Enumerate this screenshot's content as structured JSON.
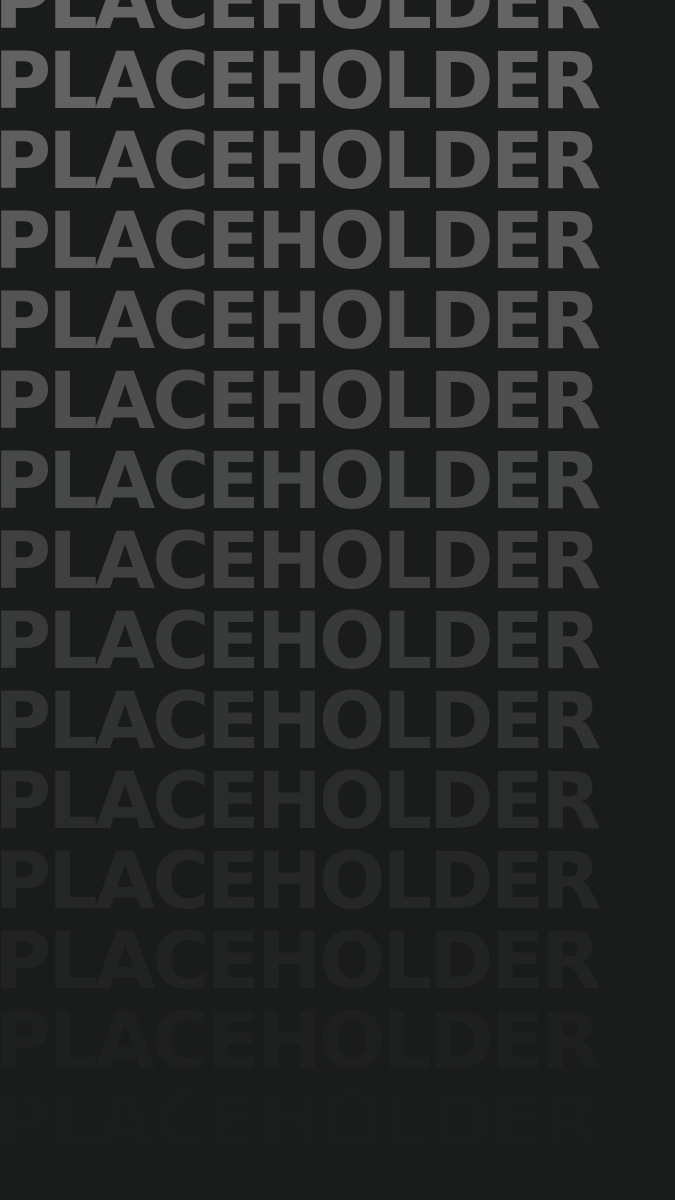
{
  "background_color": "#1a1b1b",
  "text_color": "#666666",
  "lines": [
    "PLACEHOLDER",
    "PLACEHOLDER",
    "PLACEHOLDER",
    "PLACEHOLDER",
    "PLACEHOLDER",
    "PLACEHOLDER",
    "PLACEHOLDER",
    "PLACEHOLDER",
    "PLACEHOLDER",
    "PLACEHOLDER",
    "PLACEHOLDER",
    "PLACEHOLDER",
    "PLACEHOLDER",
    "PLACEHOLDER",
    "PLACEHOLDER"
  ]
}
